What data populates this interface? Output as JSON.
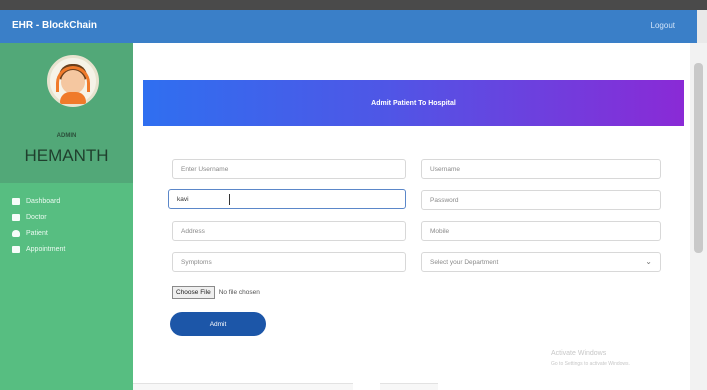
{
  "navbar": {
    "brand": "EHR - BlockChain",
    "logout": "Logout"
  },
  "sidebar": {
    "role": "ADMIN",
    "username": "HEMANTH",
    "menu": [
      {
        "label": "Dashboard",
        "icon": "dashboard-icon"
      },
      {
        "label": "Doctor",
        "icon": "doctor-icon"
      },
      {
        "label": "Patient",
        "icon": "patient-icon"
      },
      {
        "label": "Appointment",
        "icon": "calendar-icon"
      }
    ]
  },
  "form": {
    "title": "Admit Patient To Hospital",
    "fields": {
      "first_name": {
        "placeholder": "Enter Username",
        "value": ""
      },
      "last_name": {
        "placeholder": "Username",
        "value": ""
      },
      "username": {
        "placeholder": "",
        "value": "kavi"
      },
      "password": {
        "placeholder": "Password",
        "value": ""
      },
      "address": {
        "placeholder": "Address",
        "value": ""
      },
      "mobile": {
        "placeholder": "Mobile",
        "value": ""
      },
      "symptoms": {
        "placeholder": "Symptoms",
        "value": ""
      },
      "department": {
        "selected": "Select your Department"
      }
    },
    "file": {
      "button_label": "Choose File",
      "status": "No file chosen"
    },
    "submit_label": "Admit"
  },
  "watermark": {
    "line1": "Activate Windows",
    "line2": "Go to Settings to activate Windows."
  }
}
